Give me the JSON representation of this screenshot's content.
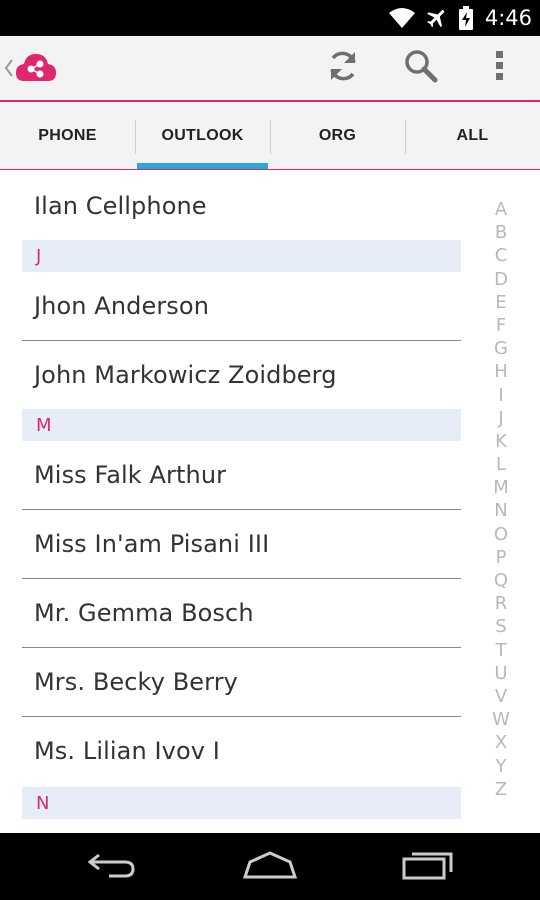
{
  "status_bar": {
    "time": "4:46",
    "icons": [
      "wifi-icon",
      "airplane-icon",
      "battery-charging-icon"
    ]
  },
  "action_bar": {
    "logo": "app-logo-icon",
    "actions": [
      "refresh-icon",
      "search-icon",
      "overflow-menu-icon"
    ],
    "accent_color": "#e0266f"
  },
  "tabs": [
    {
      "label": "PHONE",
      "selected": false
    },
    {
      "label": "OUTLOOK",
      "selected": true
    },
    {
      "label": "ORG",
      "selected": false
    },
    {
      "label": "ALL",
      "selected": false
    }
  ],
  "contacts": {
    "first": "Ilan Cellphone",
    "section_j": {
      "header": "J",
      "items": [
        "Jhon Anderson",
        "John Markowicz Zoidberg"
      ]
    },
    "section_m": {
      "header": "M",
      "items": [
        "Miss Falk Arthur",
        "Miss In'am Pisani III",
        "Mr. Gemma Bosch",
        "Mrs. Becky Berry",
        "Ms. Lilian Ivov I"
      ]
    },
    "section_n": {
      "header": "N"
    }
  },
  "alphabet_index": [
    "A",
    "B",
    "C",
    "D",
    "E",
    "F",
    "G",
    "H",
    "I",
    "J",
    "K",
    "L",
    "M",
    "N",
    "O",
    "P",
    "Q",
    "R",
    "S",
    "T",
    "U",
    "V",
    "W",
    "X",
    "Y",
    "Z"
  ],
  "nav_bar": [
    "back-icon",
    "home-icon",
    "recents-icon"
  ]
}
